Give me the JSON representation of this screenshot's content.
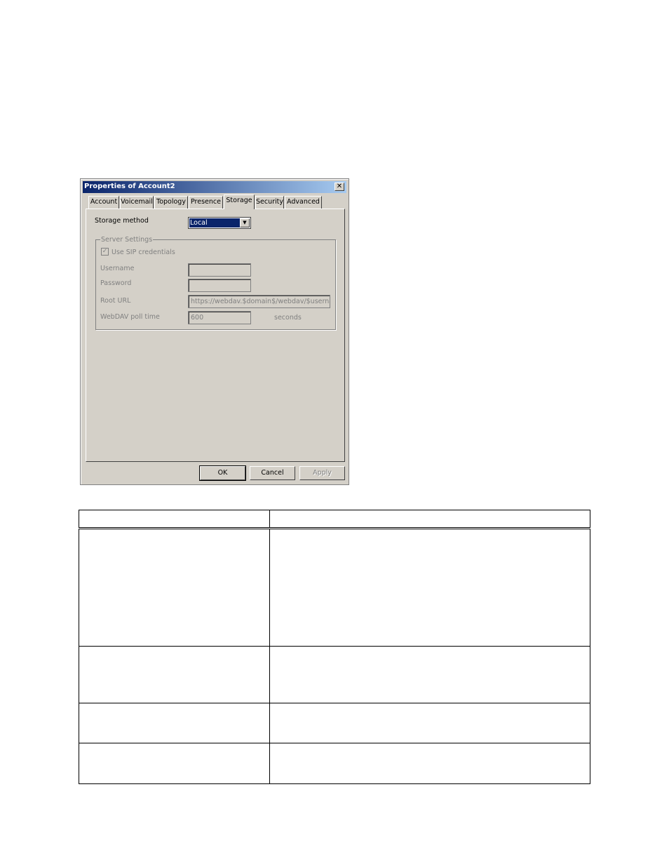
{
  "dialog": {
    "title": "Properties of Account2",
    "close_glyph": "✕",
    "tabs": [
      {
        "label": "Account",
        "active": false
      },
      {
        "label": "Voicemail",
        "active": false
      },
      {
        "label": "Topology",
        "active": false
      },
      {
        "label": "Presence",
        "active": false
      },
      {
        "label": "Storage",
        "active": true
      },
      {
        "label": "Security",
        "active": false
      },
      {
        "label": "Advanced",
        "active": false
      }
    ],
    "storage": {
      "method_label": "Storage method",
      "method_value": "Local",
      "dropdown_arrow": "▼",
      "server_settings": {
        "title": "Server Settings",
        "use_sip_label": "Use SIP credentials",
        "use_sip_checked": true,
        "check_glyph": "✓",
        "username_label": "Username",
        "username_value": "",
        "password_label": "Password",
        "password_value": "",
        "root_url_label": "Root URL",
        "root_url_value": "https://webdav.$domain$/webdav/$username",
        "poll_label": "WebDAV poll time",
        "poll_value": "600",
        "poll_unit": "seconds"
      }
    },
    "buttons": {
      "ok": "OK",
      "cancel": "Cancel",
      "apply": "Apply"
    }
  },
  "doc_table": {
    "rows": 5,
    "columns": 2
  }
}
